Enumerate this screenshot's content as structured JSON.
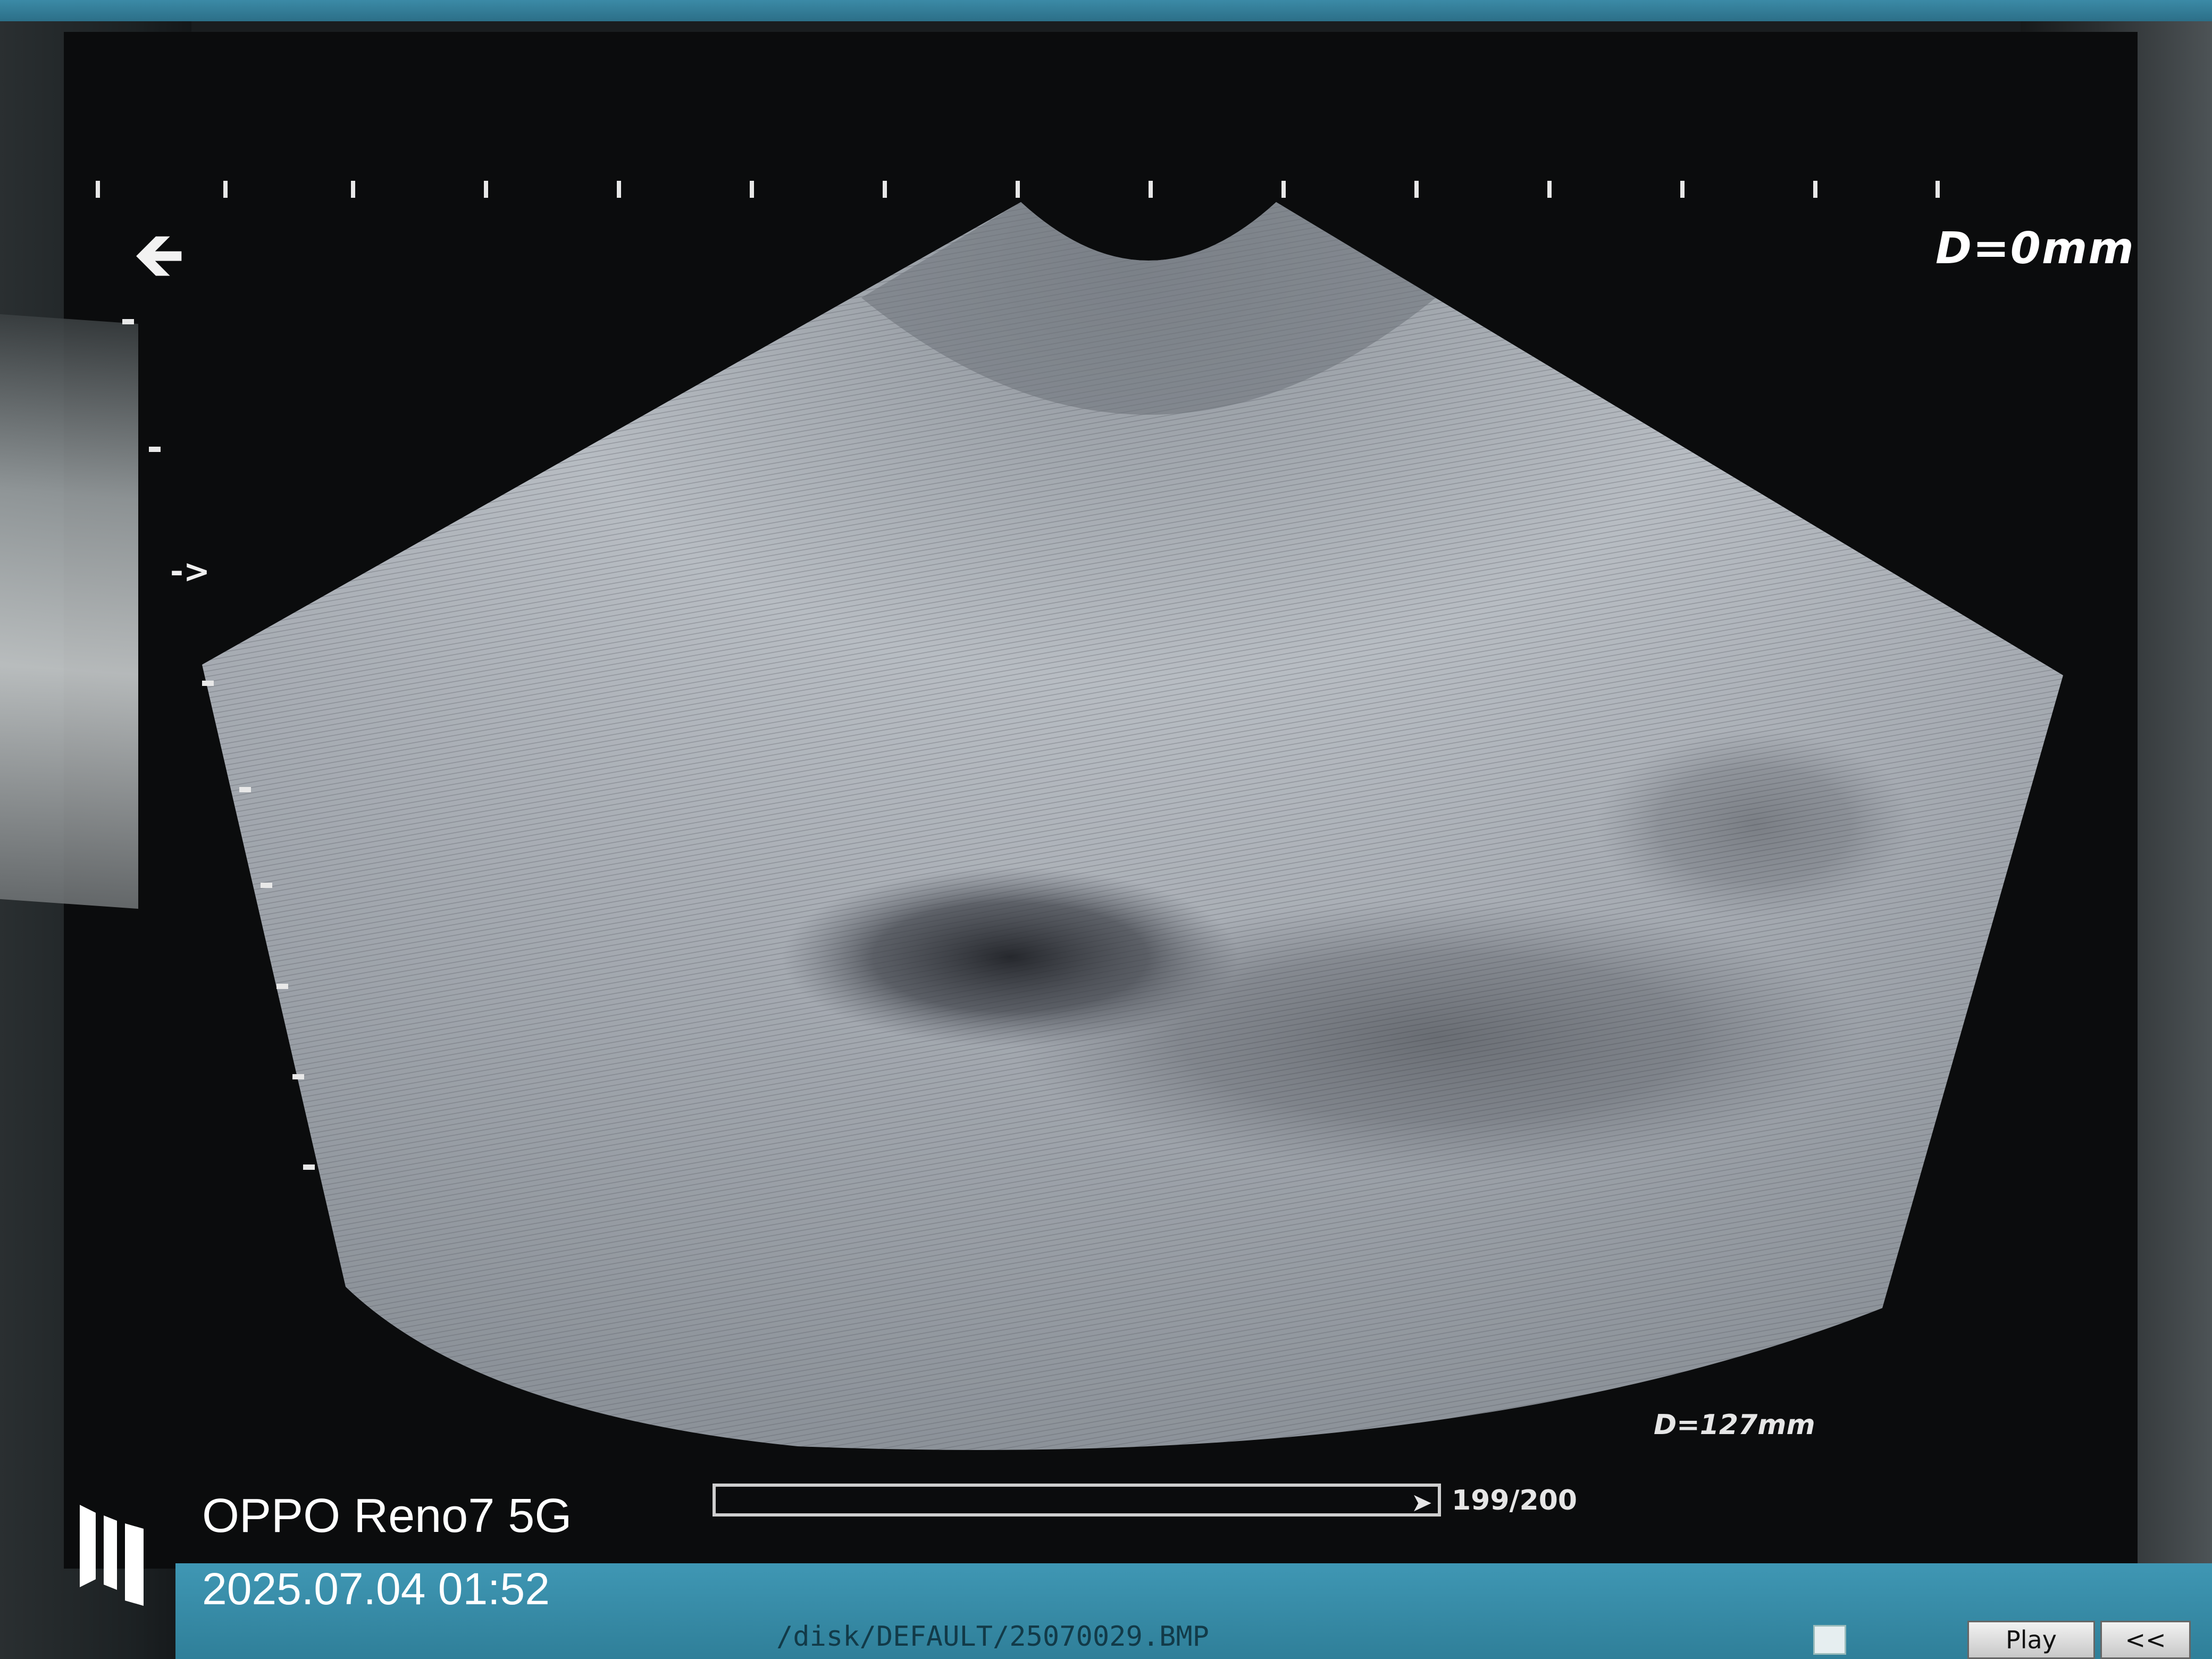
{
  "screen": {
    "depth_top": "D=0mm",
    "depth_bottom": "D=127mm",
    "frame_counter": "199/200",
    "progress_fraction": 0.995,
    "direction_marker": "->",
    "back_arrow_icon": "left-arrow-icon"
  },
  "status_bar": {
    "file_path": "/disk/DEFAULT/25070029.BMP",
    "play_label": "Play",
    "back_label": "<<"
  },
  "watermark": {
    "model": "OPPO Reno7 5G",
    "datetime": "2025.07.04 01:52"
  },
  "colors": {
    "status_bar": "#2f7f99",
    "screen_bg": "#0b0c0d"
  }
}
